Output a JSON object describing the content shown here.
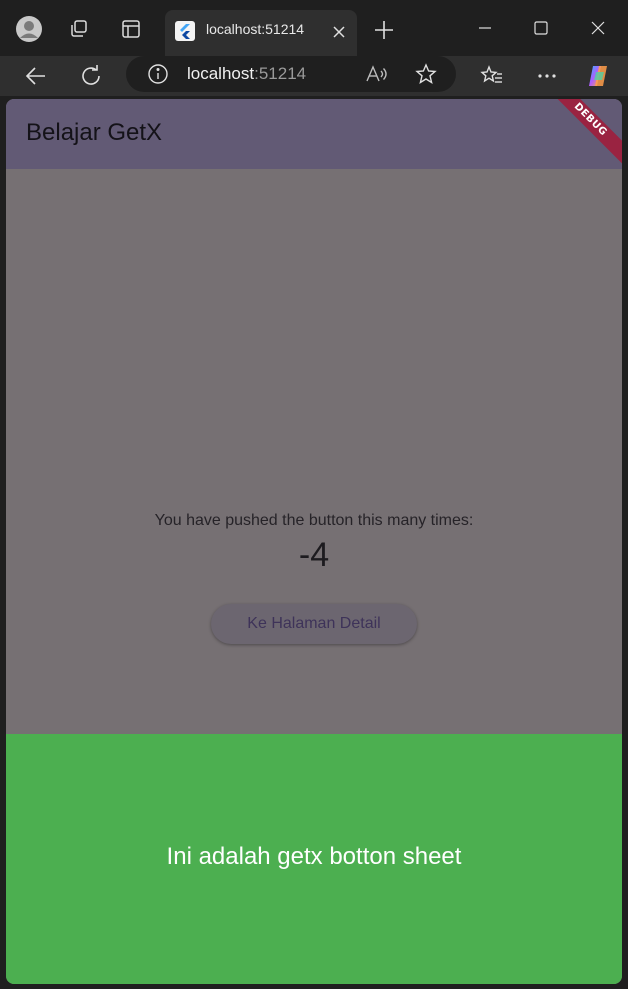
{
  "browser": {
    "tab_title": "localhost:51214",
    "url_host": "localhost",
    "url_port": ":51214"
  },
  "app": {
    "title": "Belajar GetX",
    "debug_banner": "DEBUG",
    "counter_label": "You have pushed the button this many times:",
    "counter_value": "-4",
    "detail_button": "Ke Halaman Detail",
    "bottom_sheet_text": "Ini adalah getx botton sheet"
  },
  "colors": {
    "appbar": "#625a75",
    "scrim_body": "#767073",
    "bottom_sheet": "#4caf50",
    "debug_banner": "#9a2341"
  }
}
